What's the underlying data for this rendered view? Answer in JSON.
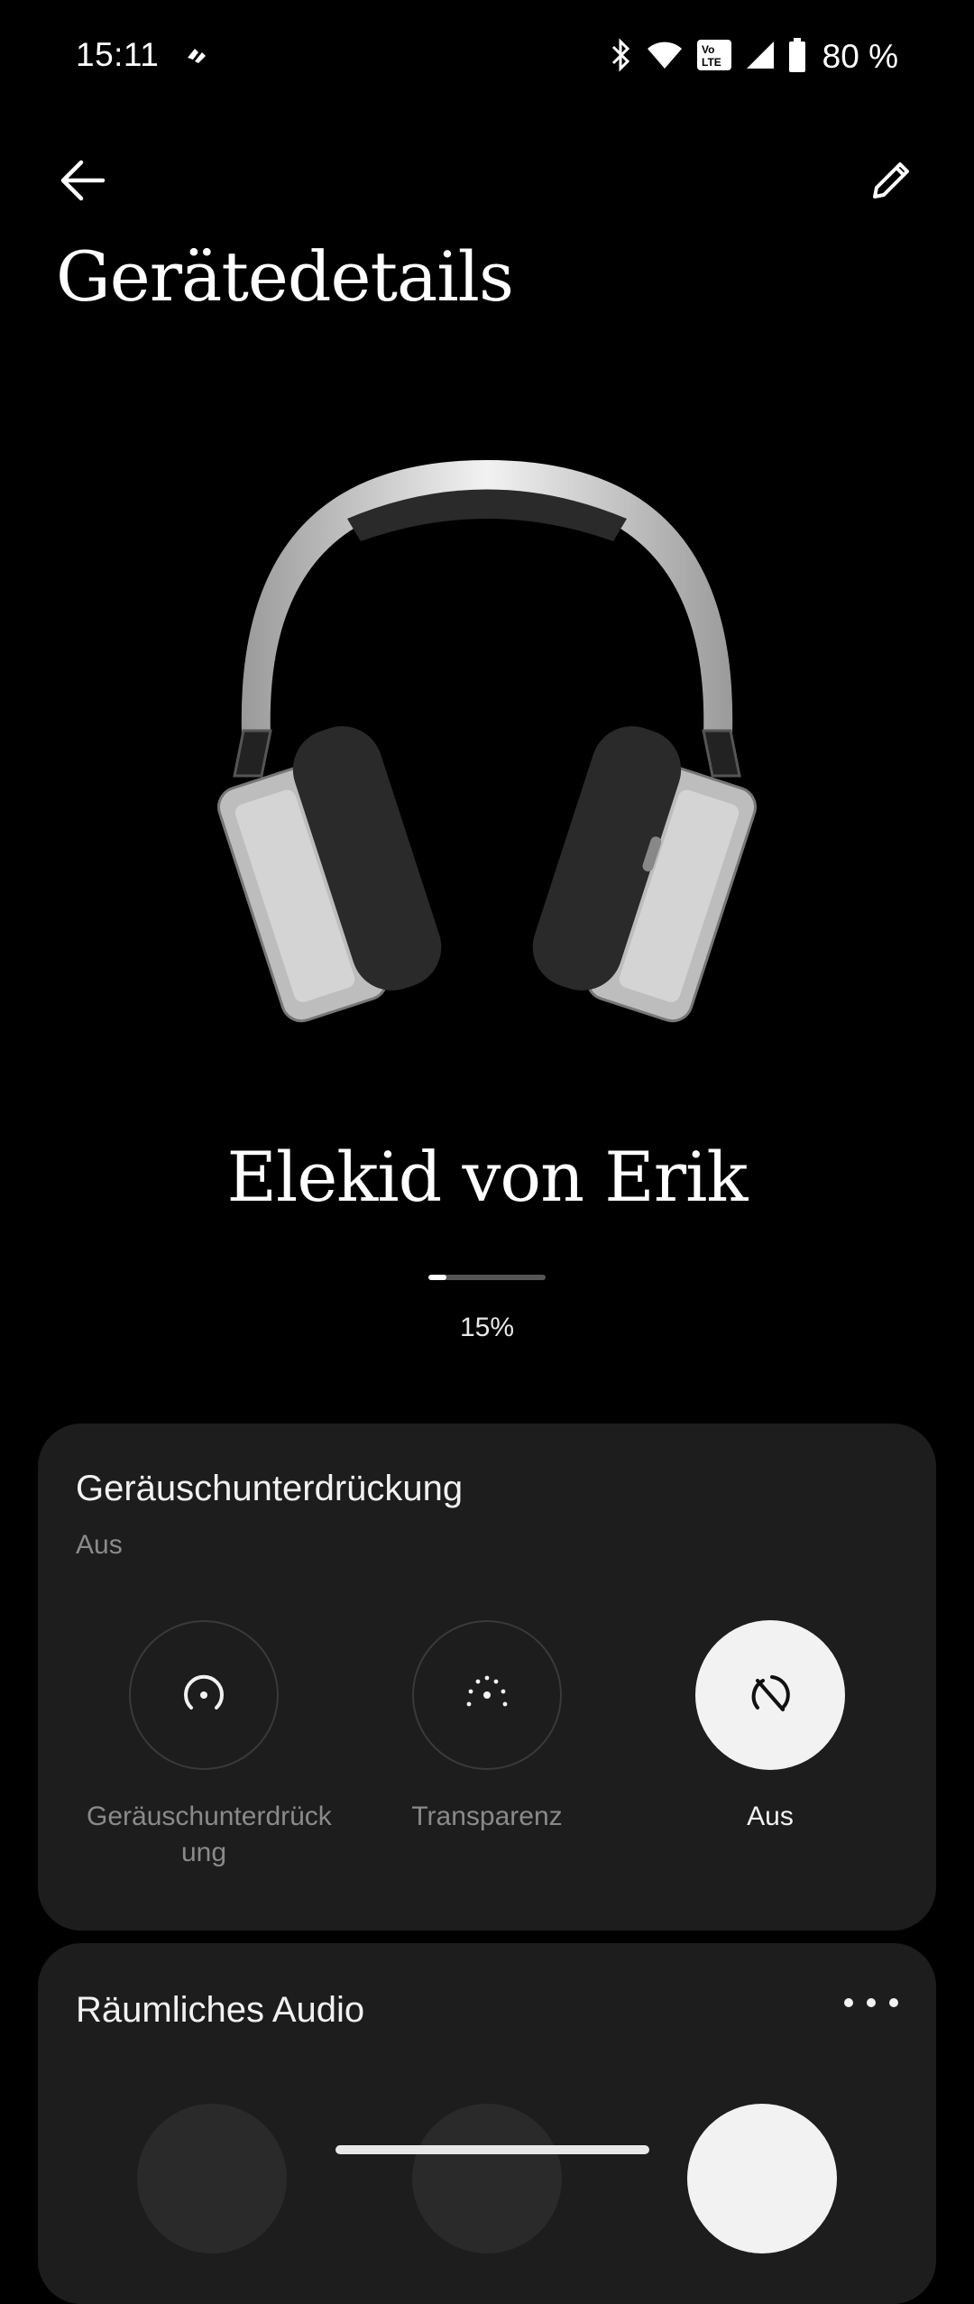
{
  "status_bar": {
    "time": "15:11",
    "battery_percent": "80 %",
    "icons": [
      "bluetooth-icon",
      "wifi-icon",
      "volte-icon",
      "cell-signal-icon",
      "battery-icon"
    ]
  },
  "header": {
    "title": "Gerätedetails"
  },
  "device": {
    "name": "Elekid von Erik",
    "battery_label": "15%",
    "battery_level": 0.15
  },
  "anc_card": {
    "title": "Geräuschunterdrückung",
    "status": "Aus",
    "modes": [
      {
        "label": "Geräuschunterdrück ung",
        "icon": "noise-cancellation-icon",
        "active": false
      },
      {
        "label": "Transparenz",
        "icon": "transparency-icon",
        "active": false
      },
      {
        "label": "Aus",
        "icon": "anc-off-icon",
        "active": true
      }
    ]
  },
  "spatial_card": {
    "title": "Räumliches Audio"
  },
  "colors": {
    "background": "#000000",
    "card": "#1d1d1d",
    "active": "#f2f2f2",
    "muted": "#8a8a8a"
  }
}
